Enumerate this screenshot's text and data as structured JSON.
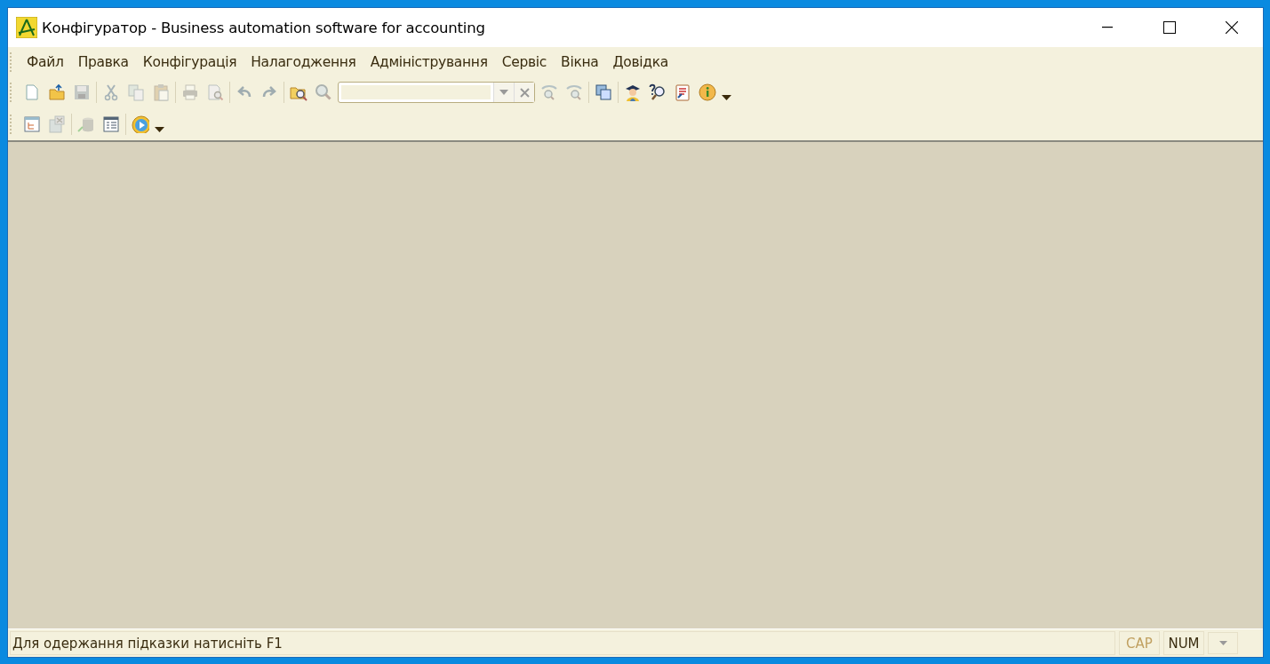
{
  "window": {
    "title": "Конфігуратор - Business automation software for accounting"
  },
  "menu": [
    "Файл",
    "Правка",
    "Конфігурація",
    "Налагодження",
    "Адміністрування",
    "Сервіс",
    "Вікна",
    "Довідка"
  ],
  "toolbars": [
    {
      "buttons": [
        {
          "disabled": false
        },
        {
          "disabled": false
        },
        {
          "disabled": true
        },
        {
          "disabled": true
        },
        {
          "disabled": true
        },
        {
          "disabled": true
        },
        {
          "disabled": true
        },
        {
          "disabled": true
        },
        {
          "disabled": true
        },
        {
          "disabled": true
        },
        {
          "disabled": false
        },
        {
          "disabled": true
        },
        {
          "disabled": true
        },
        {
          "disabled": true
        },
        {
          "disabled": false
        },
        {
          "disabled": false
        },
        {
          "disabled": false
        },
        {
          "disabled": false
        },
        {
          "disabled": false
        }
      ]
    },
    {
      "buttons": [
        {
          "disabled": false
        },
        {
          "disabled": true
        },
        {
          "disabled": true
        },
        {
          "disabled": false
        },
        {
          "disabled": false
        }
      ]
    }
  ],
  "status_bar": {
    "hint": "Для одержання підказки натисніть F1",
    "indicators": [
      {
        "label": "CAP",
        "on": false
      },
      {
        "label": "NUM",
        "on": true
      }
    ]
  }
}
